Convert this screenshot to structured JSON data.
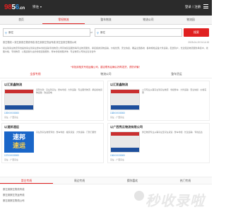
{
  "header": {
    "logo_a": "9",
    "logo_b": "8",
    "logo_c": "5",
    "logo_d": "6",
    "logo_e": ".cn",
    "city": "崇左",
    "login": "登录丨注册"
  },
  "nav": [
    "首页",
    "零担物流",
    "整车物流",
    "物流公司",
    "物流园"
  ],
  "search": {
    "from": "崇左",
    "to": "崇左",
    "button": "搜索",
    "swap": "⇌"
  },
  "breadcrumb": {
    "text": "崇左物流 > 崇左到崇左物流专线 崇左到崇左货运专线 崇左至崇左物流公司",
    "time": "2025-04-19 01:14:15"
  },
  "intro": "崇左到崇左物流专线提供崇左到崇左整车零担运输专线物流公司同城货运服务等专业物流服务，承接各类货物运输，价格优惠，安全快捷，覆盖全国各地 · 各种规格设备大件运输，配送到户，长途短途物流服务承接中，线路价格，专线物流 · 公路运输为主的零担运输服务，整车零担线路详询 · 专业物流公司欢迎洽谈合作",
  "notice": "*你找到相关专线运输公司，建议联系后确认好再发货，谨防诈骗！",
  "tabs": [
    "全部专线",
    "物流公司",
    "整车货运"
  ],
  "cards": [
    {
      "title": "以汇凯鑫物流",
      "info": "货到付款 · 崇左到崇左 · 整车零担 · 大件运输 · 专业服务物流 · 承接各地货物运输 · 欢迎来电",
      "phone": "139XXXX0000",
      "addr": "崇左 · 广西崇左"
    },
    {
      "title": "以汇凯鑫物流",
      "info": "公司专业从事崇左到崇左物流 · 零担整车 · 大件运输 · 安全快捷 · 价格实惠",
      "phone": "138XXXX0000",
      "addr": "崇左 · 广西崇左"
    },
    {
      "title": "以速邦速运",
      "info": "崇左到崇左物流专线 · 整车零担 · 搬家货运 · 大件运输 · 门到门服务",
      "phone": "137XXXX0000",
      "addr": "崇左 · 广西崇左",
      "tile_a": "速邦",
      "tile_b": "速运"
    },
    {
      "title": "以广西秀云物流有限公司",
      "info": "秀云物流专业从事崇左至崇左货运 · 整车零担 · 长途运输 · 专线直达",
      "phone": "136XXXX0000",
      "addr": "崇左 · 广西崇左"
    }
  ],
  "bottom_tabs": [
    "崇左专线",
    "周边专线",
    "猜你喜欢",
    "热门专线"
  ],
  "links": [
    "崇左到崇左物流专线",
    "崇左到崇左货运专线",
    "崇左到崇左物流公司"
  ],
  "watermark": "秒收录啦"
}
